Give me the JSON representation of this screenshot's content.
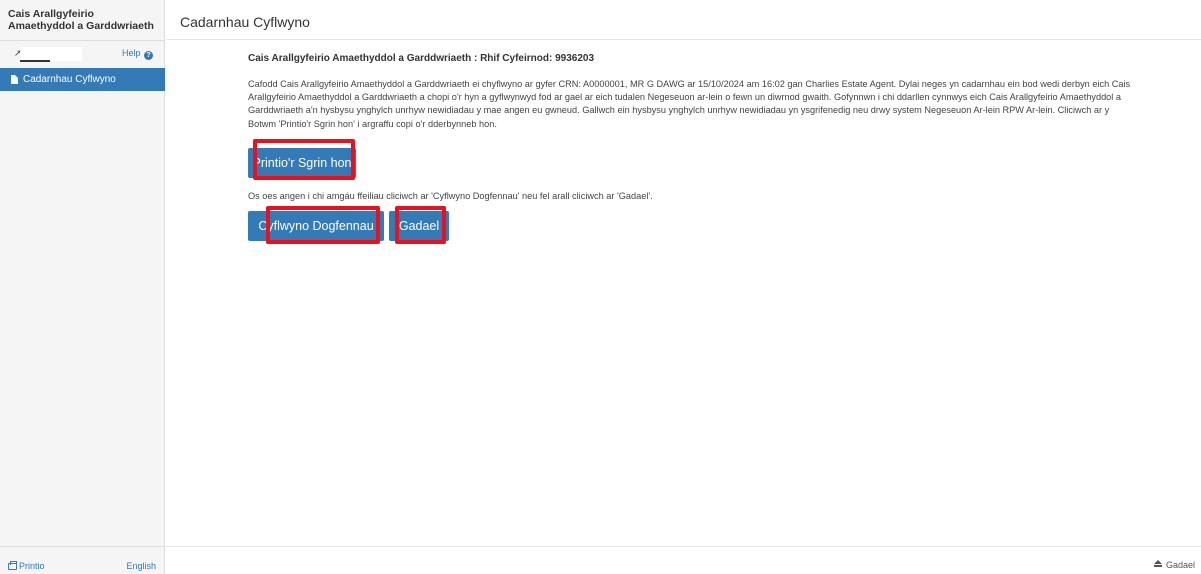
{
  "sidebar": {
    "title_line1": "Cais Arallgyfeirio",
    "title_line2": "Amaethyddol a Garddwriaeth",
    "help_label": "Help",
    "items": [
      {
        "label": "Cadarnhau Cyflwyno",
        "icon": "document-icon",
        "active": true
      }
    ],
    "print_label": "Printio",
    "language_label": "English"
  },
  "header": {
    "title": "Cadarnhau Cyflwyno"
  },
  "main": {
    "heading": "Cais Arallgyfeirio Amaethyddol a Garddwriaeth : Rhif Cyfeirnod: 9936203",
    "paragraph": "Cafodd Cais Arallgyfeirio Amaethyddol a Garddwriaeth ei chyflwyno ar gyfer CRN: A0000001, MR G DAWG ar 15/10/2024 am 16:02 gan Charlies Estate Agent. Dylai neges yn cadarnhau ein bod wedi derbyn eich Cais Arallgyfeirio Amaethyddol a Garddwriaeth a chopi o'r hyn a gyflwynwyd fod ar gael ar eich tudalen Negeseuon ar-lein o fewn un diwrnod gwaith. Gofynnwn i chi ddarllen cynnwys eich Cais Arallgyfeirio Amaethyddol a Garddwriaeth a'n hysbysu ynghylch unrhyw newidiadau y mae angen eu gwneud. Gallwch ein hysbysu ynghylch unrhyw newidiadau yn ysgrifenedig neu drwy system Negeseuon Ar-lein RPW Ar-lein. Cliciwch ar y Botwm 'Printio'r Sgrin hon' i argraffu copi o'r dderbynneb hon.",
    "print_button": "Printio'r Sgrin hon",
    "note": "Os oes angen i chi amgáu ffeiliau cliciwch ar 'Cyflwyno Dogfennau' neu fel arall cliciwch ar 'Gadael'.",
    "submit_docs_button": "Cyflwyno Dogfennau",
    "exit_button": "Gadael"
  },
  "footer": {
    "exit_label": "Gadael"
  },
  "colors": {
    "accent": "#337ab7",
    "highlight": "#e8121e"
  }
}
